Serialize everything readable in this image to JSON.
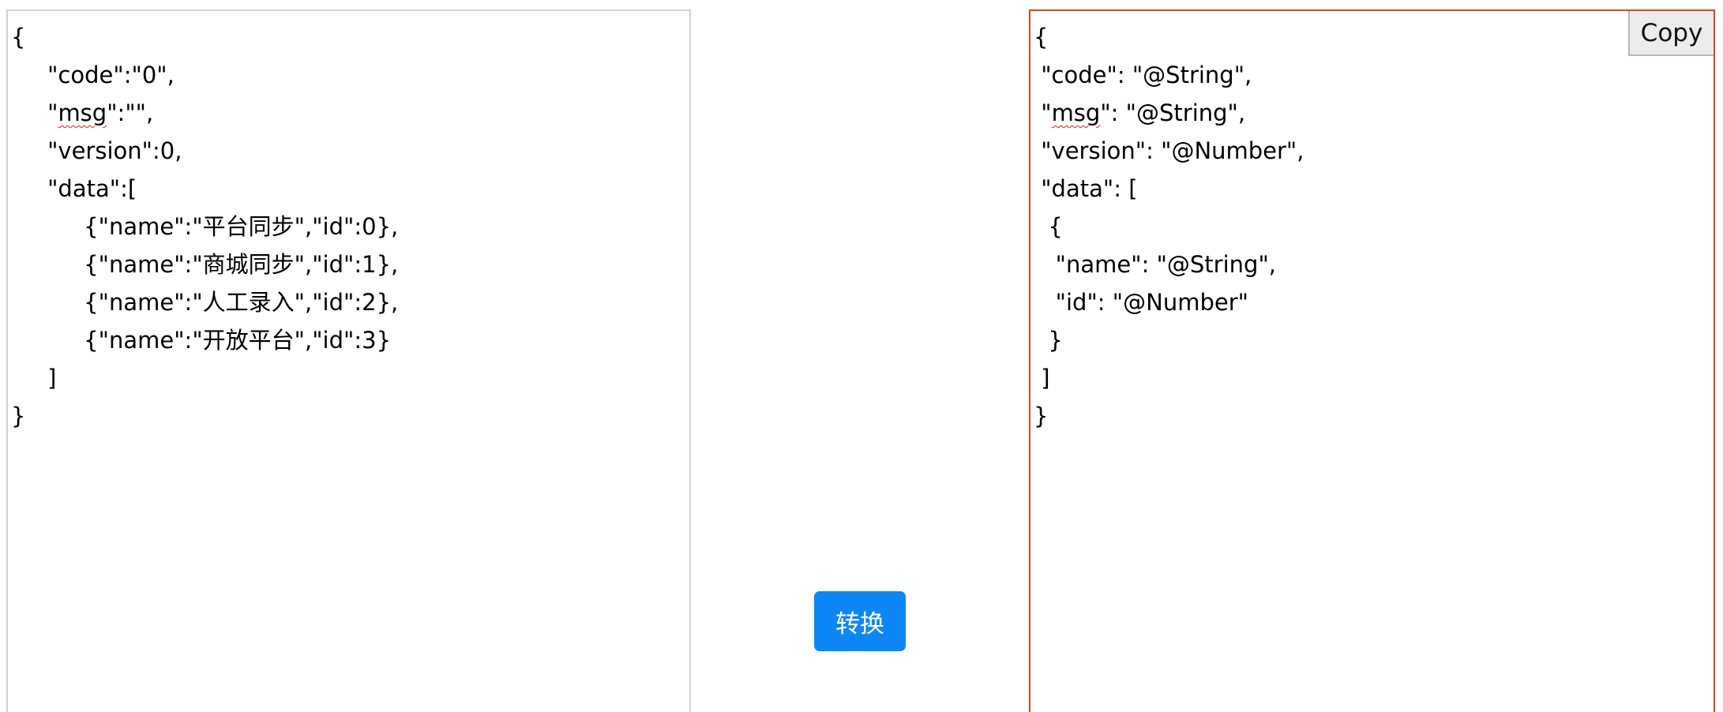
{
  "input_panel": {
    "lines": [
      "{",
      "     \"code\":\"0\",",
      "     \"msg\":\"\",",
      "     \"version\":0,",
      "     \"data\":[",
      "          {\"name\":\"平台同步\",\"id\":0},",
      "          {\"name\":\"商城同步\",\"id\":1},",
      "          {\"name\":\"人工录入\",\"id\":2},",
      "          {\"name\":\"开放平台\",\"id\":3}",
      "     ]",
      "}"
    ]
  },
  "convert_button": {
    "label": "转换",
    "color": "#0d87f6"
  },
  "output_panel": {
    "copy_label": "Copy",
    "border_color": "#e0431c",
    "lines": [
      "{",
      " \"code\": \"@String\",",
      " \"msg\": \"@String\",",
      " \"version\": \"@Number\",",
      " \"data\": [",
      "  {",
      "   \"name\": \"@String\",",
      "   \"id\": \"@Number\"",
      "  }",
      " ]",
      "}"
    ]
  }
}
